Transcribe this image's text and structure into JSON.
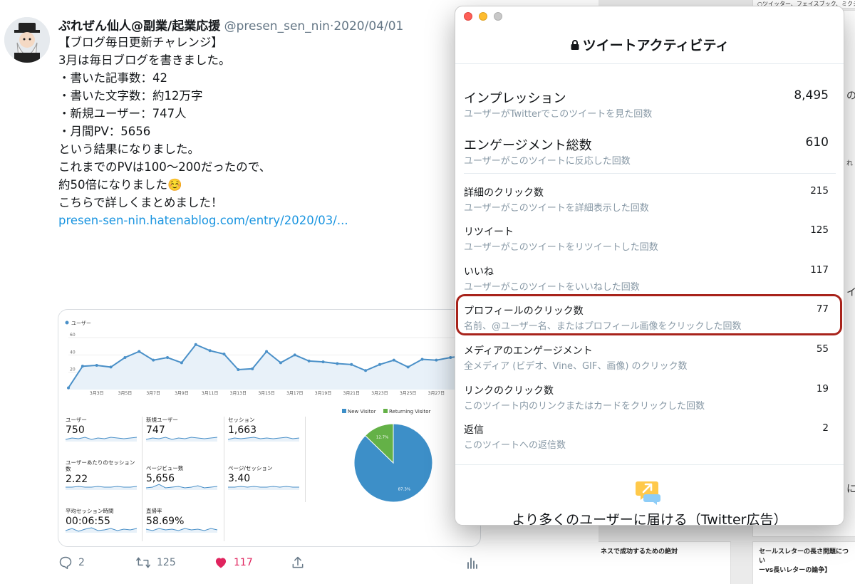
{
  "tweet": {
    "author_name": "ぷれぜん仙人@副業/起業応援",
    "handle": "@presen_sen_nin",
    "date": "2020/04/01",
    "lines": [
      "【ブログ毎日更新チャレンジ】",
      "",
      "3月は毎日ブログを書きました。",
      "",
      "・書いた記事数：42",
      "・書いた文字数：約12万字",
      "・新規ユーザー：747人",
      "・月間PV：5656",
      "",
      "という結果になりました。",
      "これまでのPVは100〜200だったので、",
      "約50倍になりました☺️",
      "",
      "こちらで詳しくまとめました！"
    ],
    "link": "presen-sen-nin.hatenablog.com/entry/2020/03/...",
    "actions": {
      "replies": "2",
      "retweets": "125",
      "likes": "117"
    }
  },
  "analytics_image": {
    "metrics": [
      {
        "label": "ユーザー",
        "value": "750"
      },
      {
        "label": "新規ユーザー",
        "value": "747"
      },
      {
        "label": "セッション",
        "value": "1,663"
      },
      {
        "label": "ユーザーあたりのセッション数",
        "value": "2.22"
      },
      {
        "label": "ページビュー数",
        "value": "5,656"
      },
      {
        "label": "ページ/セッション",
        "value": "3.40"
      },
      {
        "label": "平均セッション時間",
        "value": "00:06:55"
      },
      {
        "label": "直帰率",
        "value": "58.69%"
      }
    ]
  },
  "chart_data": [
    {
      "type": "area",
      "legend": [
        "ユーザー"
      ],
      "x_tick_labels": [
        "3月3日",
        "3月5日",
        "3月7日",
        "3月9日",
        "3月11日",
        "3月13日",
        "3月15日",
        "3月17日",
        "3月19日",
        "3月21日",
        "3月23日",
        "3月25日",
        "3月27日",
        "3月29日"
      ],
      "y_tick_labels": [
        "60",
        "40",
        "20"
      ],
      "ylim": [
        0,
        65
      ],
      "series": [
        {
          "name": "ユーザー",
          "values": [
            2,
            27,
            28,
            26,
            37,
            44,
            34,
            37,
            31,
            52,
            45,
            41,
            23,
            24,
            44,
            31,
            40,
            33,
            32,
            30,
            29,
            22,
            29,
            34,
            26,
            35,
            34,
            37,
            39,
            41
          ]
        }
      ],
      "colors": {
        "line": "#4a90c8",
        "fill": "#e8f1f9"
      }
    },
    {
      "type": "pie",
      "legend": [
        "New Visitor",
        "Returning Visitor"
      ],
      "values": [
        87.3,
        12.7
      ],
      "labels": [
        "87.3%",
        "12.7%"
      ],
      "colors": [
        "#3d8fc8",
        "#64b147"
      ]
    }
  ],
  "activity": {
    "title": "ツイートアクティビティ",
    "rows": [
      {
        "label": "インプレッション",
        "sub": "ユーザーがTwitterでこのツイートを見た回数",
        "value": "8,495"
      },
      {
        "label": "エンゲージメント総数",
        "sub": "ユーザーがこのツイートに反応した回数",
        "value": "610"
      },
      {
        "label": "詳細のクリック数",
        "sub": "ユーザーがこのツイートを詳細表示した回数",
        "value": "215"
      },
      {
        "label": "リツイート",
        "sub": "ユーザーがこのツイートをリツイートした回数",
        "value": "125"
      },
      {
        "label": "いいね",
        "sub": "ユーザーがこのツイートをいいねした回数",
        "value": "117"
      },
      {
        "label": "プロフィールのクリック数",
        "sub": "名前、@ユーザー名、またはプロフィール画像をクリックした回数",
        "value": "77"
      },
      {
        "label": "メディアのエンゲージメント",
        "sub": "全メディア (ビデオ、Vine、GIF、画像) のクリック数",
        "value": "55"
      },
      {
        "label": "リンクのクリック数",
        "sub": "このツイート内のリンクまたはカードをクリックした回数",
        "value": "19"
      },
      {
        "label": "返信",
        "sub": "このツイートへの返信数",
        "value": "2"
      }
    ],
    "promo": "より多くのユーザーに届ける（Twitter広告）",
    "highlight_color": "#a8231b"
  },
  "background": {
    "top_card_text": "○ツイッター、フェイスブック、ミクシィと",
    "card_left_text": "ネスで成功するための絶対",
    "card_right_lines": [
      "セールスレターの長さ問題につい",
      "ーvs長いレターの論争】"
    ],
    "edge_chars": [
      "の",
      "れ",
      "イ",
      "に"
    ]
  }
}
